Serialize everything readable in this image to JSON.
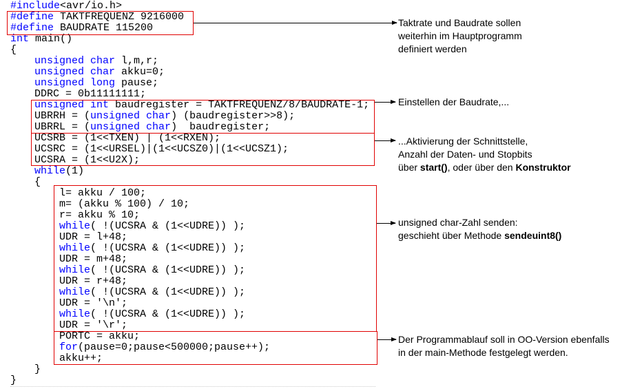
{
  "code": {
    "keyword_color": "#0000ff",
    "box_color": "#e00000",
    "lines": [
      {
        "indent": 0,
        "parts": [
          {
            "t": "#include",
            "kw": true
          },
          {
            "t": "<avr/io.h>"
          }
        ]
      },
      {
        "indent": 0,
        "parts": [
          {
            "t": "#define",
            "kw": true
          },
          {
            "t": " TAKTFREQUENZ 9216000"
          }
        ]
      },
      {
        "indent": 0,
        "parts": [
          {
            "t": "#define",
            "kw": true
          },
          {
            "t": " BAUDRATE 115200"
          }
        ]
      },
      {
        "indent": 0,
        "parts": [
          {
            "t": "int",
            "kw": true
          },
          {
            "t": " main()"
          }
        ]
      },
      {
        "indent": 0,
        "parts": [
          {
            "t": "{"
          }
        ]
      },
      {
        "indent": 1,
        "parts": [
          {
            "t": "unsigned",
            "kw": true
          },
          {
            "t": " "
          },
          {
            "t": "char",
            "kw": true
          },
          {
            "t": " l,m,r;"
          }
        ]
      },
      {
        "indent": 1,
        "parts": [
          {
            "t": "unsigned",
            "kw": true
          },
          {
            "t": " "
          },
          {
            "t": "char",
            "kw": true
          },
          {
            "t": " akku=0;"
          }
        ]
      },
      {
        "indent": 1,
        "parts": [
          {
            "t": "unsigned",
            "kw": true
          },
          {
            "t": " "
          },
          {
            "t": "long",
            "kw": true
          },
          {
            "t": " pause;"
          }
        ]
      },
      {
        "indent": 1,
        "parts": [
          {
            "t": "DDRC = 0b11111111;"
          }
        ]
      },
      {
        "indent": 1,
        "parts": [
          {
            "t": "unsigned",
            "kw": true
          },
          {
            "t": " "
          },
          {
            "t": "int",
            "kw": true
          },
          {
            "t": " baudregister = TAKTFREQUENZ/8/BAUDRATE-1;"
          }
        ]
      },
      {
        "indent": 1,
        "parts": [
          {
            "t": "UBRRH = ("
          },
          {
            "t": "unsigned",
            "kw": true
          },
          {
            "t": " "
          },
          {
            "t": "char",
            "kw": true
          },
          {
            "t": ") (baudregister>>8);"
          }
        ]
      },
      {
        "indent": 1,
        "parts": [
          {
            "t": "UBRRL = ("
          },
          {
            "t": "unsigned",
            "kw": true
          },
          {
            "t": " "
          },
          {
            "t": "char",
            "kw": true
          },
          {
            "t": ")  baudregister;"
          }
        ]
      },
      {
        "indent": 1,
        "parts": [
          {
            "t": "UCSRB = (1<<TXEN) | (1<<RXEN);"
          }
        ]
      },
      {
        "indent": 1,
        "parts": [
          {
            "t": "UCSRC = (1<<URSEL)|(1<<UCSZ0)|(1<<UCSZ1);"
          }
        ]
      },
      {
        "indent": 1,
        "parts": [
          {
            "t": "UCSRA = (1<<U2X);"
          }
        ]
      },
      {
        "indent": 1,
        "parts": [
          {
            "t": "while",
            "kw": true
          },
          {
            "t": "(1)"
          }
        ]
      },
      {
        "indent": 1,
        "parts": [
          {
            "t": "{"
          }
        ]
      },
      {
        "indent": 2,
        "parts": [
          {
            "t": "l= akku / 100;"
          }
        ]
      },
      {
        "indent": 2,
        "parts": [
          {
            "t": "m= (akku % 100) / 10;"
          }
        ]
      },
      {
        "indent": 2,
        "parts": [
          {
            "t": "r= akku % 10;"
          }
        ]
      },
      {
        "indent": 2,
        "parts": [
          {
            "t": "while",
            "kw": true
          },
          {
            "t": "( !(UCSRA & (1<<UDRE)) );"
          }
        ]
      },
      {
        "indent": 2,
        "parts": [
          {
            "t": "UDR = l+48;"
          }
        ]
      },
      {
        "indent": 2,
        "parts": [
          {
            "t": "while",
            "kw": true
          },
          {
            "t": "( !(UCSRA & (1<<UDRE)) );"
          }
        ]
      },
      {
        "indent": 2,
        "parts": [
          {
            "t": "UDR = m+48;"
          }
        ]
      },
      {
        "indent": 2,
        "parts": [
          {
            "t": "while",
            "kw": true
          },
          {
            "t": "( !(UCSRA & (1<<UDRE)) );"
          }
        ]
      },
      {
        "indent": 2,
        "parts": [
          {
            "t": "UDR = r+48;"
          }
        ]
      },
      {
        "indent": 2,
        "parts": [
          {
            "t": "while",
            "kw": true
          },
          {
            "t": "( !(UCSRA & (1<<UDRE)) );"
          }
        ]
      },
      {
        "indent": 2,
        "parts": [
          {
            "t": "UDR = '\\n';"
          }
        ]
      },
      {
        "indent": 2,
        "parts": [
          {
            "t": "while",
            "kw": true
          },
          {
            "t": "( !(UCSRA & (1<<UDRE)) );"
          }
        ]
      },
      {
        "indent": 2,
        "parts": [
          {
            "t": "UDR = '\\r';"
          }
        ]
      },
      {
        "indent": 2,
        "parts": [
          {
            "t": "PORTC = akku;"
          }
        ]
      },
      {
        "indent": 2,
        "parts": [
          {
            "t": "for",
            "kw": true
          },
          {
            "t": "(pause=0;pause<500000;pause++);"
          }
        ]
      },
      {
        "indent": 2,
        "parts": [
          {
            "t": "akku++;"
          }
        ]
      },
      {
        "indent": 1,
        "parts": [
          {
            "t": "}"
          }
        ]
      },
      {
        "indent": 0,
        "parts": [
          {
            "t": "}"
          }
        ]
      }
    ]
  },
  "annotations": [
    {
      "lines": [
        [
          {
            "t": "Taktrate und Baudrate sollen"
          }
        ],
        [
          {
            "t": "weiterhin im Hauptprogramm"
          }
        ],
        [
          {
            "t": "definiert werden"
          }
        ]
      ]
    },
    {
      "lines": [
        [
          {
            "t": "Einstellen der Baudrate,..."
          }
        ]
      ]
    },
    {
      "lines": [
        [
          {
            "t": "...Aktivierung der Schnittstelle,"
          }
        ],
        [
          {
            "t": "Anzahl der Daten- und Stopbits"
          }
        ],
        [
          {
            "t": "über "
          },
          {
            "t": "start()",
            "b": true
          },
          {
            "t": ", oder über den "
          },
          {
            "t": "Konstruktor",
            "b": true
          }
        ]
      ]
    },
    {
      "lines": [
        [
          {
            "t": "unsigned char-Zahl senden:"
          }
        ],
        [
          {
            "t": "geschieht über Methode "
          },
          {
            "t": "sendeuint8()",
            "b": true
          }
        ]
      ]
    },
    {
      "lines": [
        [
          {
            "t": "Der Programmablauf soll in OO-Version ebenfalls"
          }
        ],
        [
          {
            "t": "in der main-Methode festgelegt werden."
          }
        ]
      ]
    }
  ]
}
